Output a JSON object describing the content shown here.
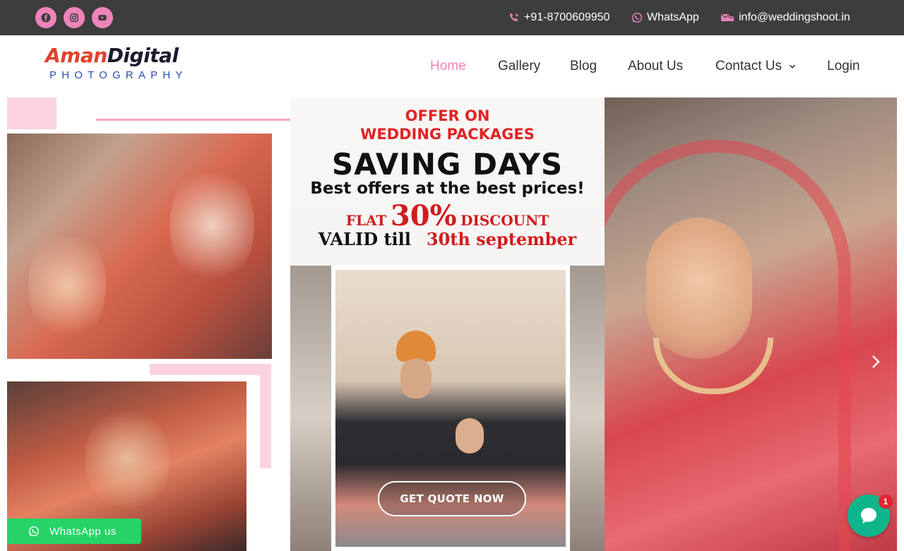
{
  "topbar": {
    "socials": [
      {
        "name": "facebook-icon"
      },
      {
        "name": "instagram-icon"
      },
      {
        "name": "youtube-icon"
      }
    ],
    "phone": "+91-8700609950",
    "whatsapp": "WhatsApp",
    "email": "info@weddingshoot.in"
  },
  "logo": {
    "aman": "Aman",
    "digital": "Digital",
    "photography": "PHOTOGRAPHY"
  },
  "nav": {
    "items": [
      {
        "label": "Home",
        "active": true
      },
      {
        "label": "Gallery"
      },
      {
        "label": "Blog"
      },
      {
        "label": "About Us"
      },
      {
        "label": "Contact Us",
        "has_dropdown": true
      },
      {
        "label": "Login"
      }
    ]
  },
  "hero": {
    "offer_line1": "OFFER ON",
    "offer_line2": "WEDDING PACKAGES",
    "headline": "SAVING DAYS",
    "subheadline": "Best offers at the best prices!",
    "flat": "FLAT",
    "percent": "30%",
    "discount": "DISCOUNT",
    "valid": "VALID till",
    "valid_date": "30th september",
    "cta": "GET QUOTE NOW"
  },
  "floating": {
    "whatsapp_label": "WhatsApp us",
    "chat_badge": "1"
  },
  "colors": {
    "accent": "#ee84b9",
    "topbar": "#3d3d3d",
    "whatsapp": "#25d366",
    "chat": "#0fb58a"
  }
}
